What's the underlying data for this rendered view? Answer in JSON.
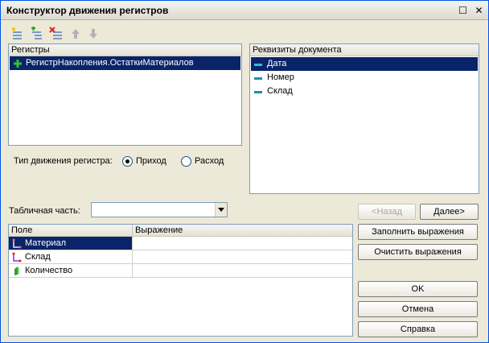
{
  "window": {
    "title": "Конструктор движения регистров",
    "close_glyph": "✕",
    "maximize_glyph": "☐"
  },
  "toolbar": {
    "icons": [
      "add-register-icon",
      "add-child-icon",
      "delete-icon",
      "move-up-icon",
      "move-down-icon"
    ]
  },
  "registers": {
    "header": "Регистры",
    "items": [
      {
        "label": "РегистрНакопления.ОстаткиМатериалов",
        "icon": "plus-green-icon",
        "selected": true
      }
    ]
  },
  "movement_type": {
    "label": "Тип движения регистра:",
    "options": [
      {
        "label": "Приход",
        "checked": true
      },
      {
        "label": "Расход",
        "checked": false
      }
    ]
  },
  "requisites": {
    "header": "Реквизиты документа",
    "items": [
      {
        "label": "Дата",
        "selected": true
      },
      {
        "label": "Номер",
        "selected": false
      },
      {
        "label": "Склад",
        "selected": false
      }
    ]
  },
  "tabular_part": {
    "label": "Табличная часть:",
    "value": ""
  },
  "grid": {
    "columns": [
      "Поле",
      "Выражение"
    ],
    "rows": [
      {
        "field": "Материал",
        "expression": "",
        "icon": "link-icon",
        "selected": true
      },
      {
        "field": "Склад",
        "expression": "",
        "icon": "link-icon",
        "selected": false
      },
      {
        "field": "Количество",
        "expression": "",
        "icon": "resource-icon",
        "selected": false
      }
    ]
  },
  "buttons": {
    "back": "<Назад",
    "next": "Далее>",
    "fill": "Заполнить выражения",
    "clear": "Очистить выражения",
    "ok": "OK",
    "cancel": "Отмена",
    "help": "Справка"
  },
  "colors": {
    "selection": "#0a246a",
    "dialog_bg": "#ece9d8",
    "border": "#7f9db9"
  }
}
